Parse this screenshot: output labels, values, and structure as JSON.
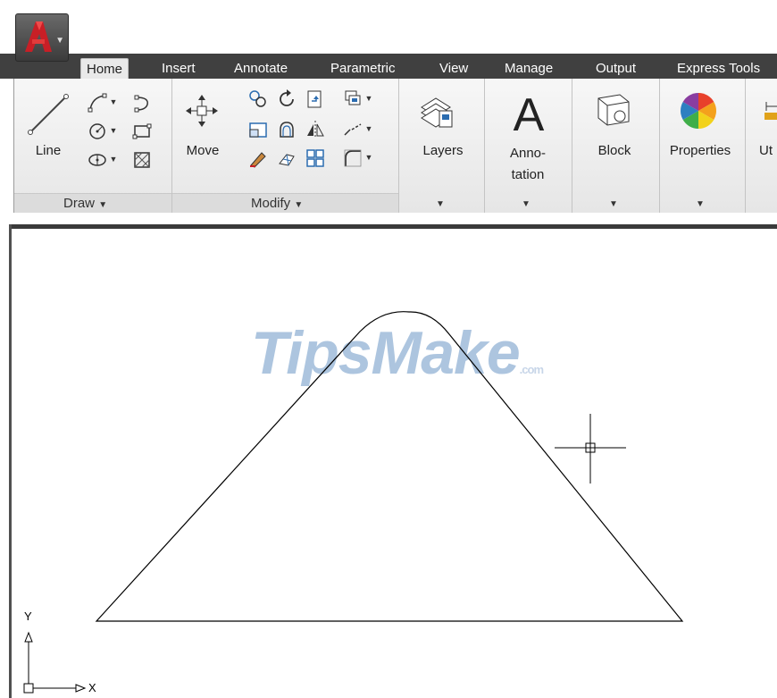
{
  "app_menu": {
    "icon": "autocad-logo-icon"
  },
  "tabs": [
    {
      "label": "Home",
      "active": true
    },
    {
      "label": "Insert"
    },
    {
      "label": "Annotate"
    },
    {
      "label": "Parametric"
    },
    {
      "label": "View"
    },
    {
      "label": "Manage"
    },
    {
      "label": "Output"
    },
    {
      "label": "Express Tools"
    }
  ],
  "ribbon": {
    "draw": {
      "panel_label": "Draw",
      "line_label": "Line",
      "tools": [
        "polyline-icon",
        "circle-icon",
        "rectangle-icon",
        "arc-icon",
        "ellipse-icon",
        "hatch-icon"
      ]
    },
    "modify": {
      "panel_label": "Modify",
      "move_label": "Move",
      "tools": [
        "copy-icon",
        "rotate-icon",
        "trim-icon",
        "array-icon",
        "stretch-icon",
        "scale-icon",
        "mirror-icon",
        "break-icon",
        "erase-icon",
        "explode-icon",
        "offset-icon",
        "fillet-icon"
      ]
    },
    "layers": {
      "label": "Layers"
    },
    "annotation": {
      "label_line1": "Anno-",
      "label_line2": "tation"
    },
    "block": {
      "label": "Block"
    },
    "properties": {
      "label": "Properties"
    },
    "utilities": {
      "label": "Ut"
    }
  },
  "canvas": {
    "watermark_main": "TipsMake",
    "watermark_suffix": ".com",
    "ucs": {
      "x_label": "X",
      "y_label": "Y"
    },
    "crosshair": {
      "visible": true
    }
  }
}
